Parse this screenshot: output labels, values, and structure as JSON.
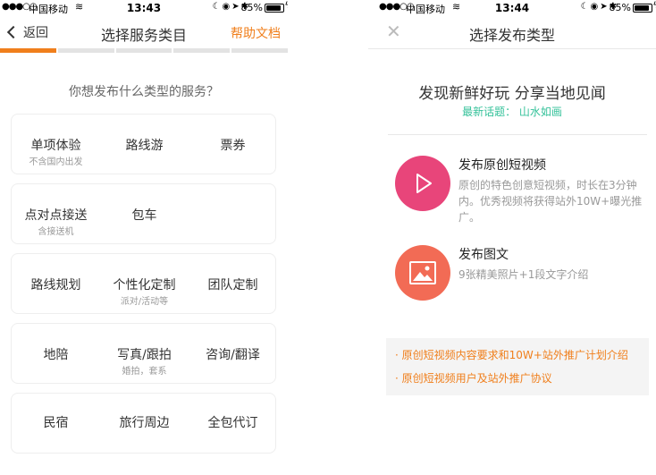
{
  "left": {
    "status": {
      "carrier": "中国移动",
      "time": "13:43",
      "battery": "85%"
    },
    "nav": {
      "back_label": "返回",
      "title": "选择服务类目",
      "help_label": "帮助文档"
    },
    "progress": {
      "segments": 5,
      "active": 1
    },
    "question": "你想发布什么类型的服务？",
    "rows": [
      [
        {
          "label": "单项体验",
          "sub": "不含国内出发"
        },
        {
          "label": "路线游",
          "sub": ""
        },
        {
          "label": "票券",
          "sub": ""
        }
      ],
      [
        {
          "label": "点对点接送",
          "sub": "含接送机"
        },
        {
          "label": "包车",
          "sub": ""
        }
      ],
      [
        {
          "label": "路线规划",
          "sub": ""
        },
        {
          "label": "个性化定制",
          "sub": "派对/活动等"
        },
        {
          "label": "团队定制",
          "sub": ""
        }
      ],
      [
        {
          "label": "地陪",
          "sub": ""
        },
        {
          "label": "写真/跟拍",
          "sub": "婚拍，套系"
        },
        {
          "label": "咨询/翻译",
          "sub": ""
        }
      ],
      [
        {
          "label": "民宿",
          "sub": ""
        },
        {
          "label": "旅行周边",
          "sub": ""
        },
        {
          "label": "全包代订",
          "sub": ""
        }
      ]
    ]
  },
  "right": {
    "status": {
      "carrier": "中国移动",
      "time": "13:44",
      "battery": "85%"
    },
    "nav": {
      "title": "选择发布类型"
    },
    "headline": "发现新鲜好玩 分享当地见闻",
    "topic": "最新话题： 山水如画",
    "options": [
      {
        "title": "发布原创短视频",
        "desc": "原创的特色创意短视频，时长在3分钟内。优秀视频将获得站外10W+曝光推广。",
        "icon": "play-icon",
        "color": "#e8457a"
      },
      {
        "title": "发布图文",
        "desc": "9张精美照片+1段文字介绍",
        "icon": "image-icon",
        "color": "#f26b55"
      }
    ],
    "links": [
      "· 原创短视频内容要求和10W+站外推广计划介绍",
      "· 原创短视频用户及站外推广协议"
    ]
  },
  "colors": {
    "accent": "#f07f1c",
    "topic": "#35c29a",
    "video": "#e8457a",
    "photo": "#f26b55"
  }
}
